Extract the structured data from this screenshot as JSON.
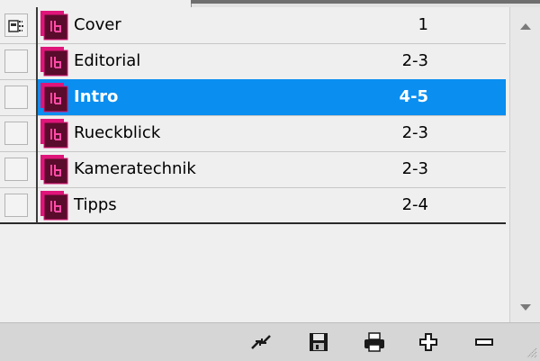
{
  "book": {
    "documents": [
      {
        "name": "Cover",
        "pages": "1",
        "checked": true,
        "selected": false
      },
      {
        "name": "Editorial",
        "pages": "2-3",
        "checked": false,
        "selected": false
      },
      {
        "name": "Intro",
        "pages": "4-5",
        "checked": false,
        "selected": true
      },
      {
        "name": "Rueckblick",
        "pages": "2-3",
        "checked": false,
        "selected": false
      },
      {
        "name": "Kameratechnik",
        "pages": "2-3",
        "checked": false,
        "selected": false
      },
      {
        "name": "Tipps",
        "pages": "2-4",
        "checked": false,
        "selected": false
      }
    ]
  },
  "icons": {
    "document": "indesign-document-icon",
    "style_source": "style-source-icon"
  },
  "toolbar": {
    "buttons": [
      {
        "name": "synchronize-button",
        "icon": "synchronize-icon"
      },
      {
        "name": "save-button",
        "icon": "save-icon"
      },
      {
        "name": "print-button",
        "icon": "print-icon"
      },
      {
        "name": "add-document-button",
        "icon": "plus-icon"
      },
      {
        "name": "remove-document-button",
        "icon": "minus-icon"
      }
    ]
  },
  "colors": {
    "selection": "#0a8ef0",
    "doc_icon": "#e0157a"
  }
}
